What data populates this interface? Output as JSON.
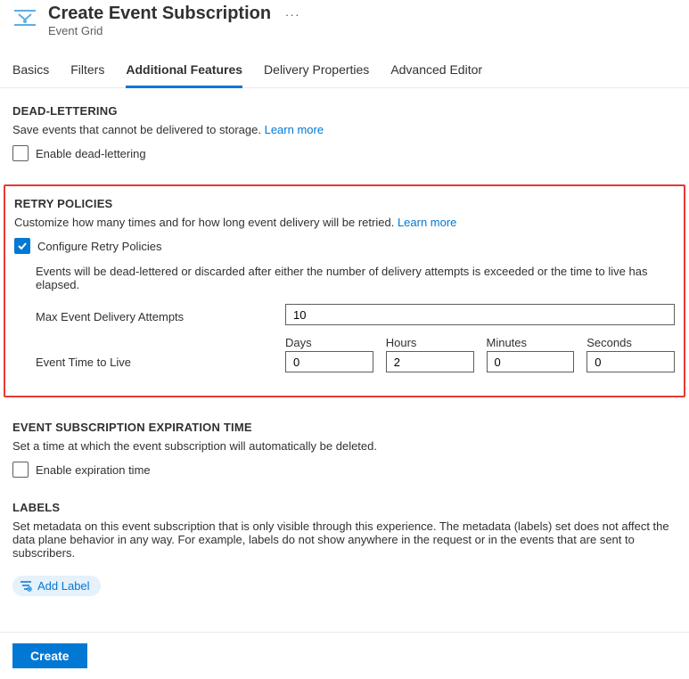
{
  "header": {
    "title": "Create Event Subscription",
    "subtitle": "Event Grid"
  },
  "tabs": {
    "basics": "Basics",
    "filters": "Filters",
    "additional": "Additional Features",
    "delivery": "Delivery Properties",
    "advanced": "Advanced Editor"
  },
  "deadLetter": {
    "title": "DEAD-LETTERING",
    "desc": "Save events that cannot be delivered to storage.",
    "learnMore": "Learn more",
    "enableLabel": "Enable dead-lettering"
  },
  "retry": {
    "title": "RETRY POLICIES",
    "desc": "Customize how many times and for how long event delivery will be retried.",
    "learnMore": "Learn more",
    "configureLabel": "Configure Retry Policies",
    "note": "Events will be dead-lettered or discarded after either the number of delivery attempts is exceeded or the time to live has elapsed.",
    "maxAttemptsLabel": "Max Event Delivery Attempts",
    "maxAttemptsValue": "10",
    "ttlLabel": "Event Time to Live",
    "ttl": {
      "daysLabel": "Days",
      "days": "0",
      "hoursLabel": "Hours",
      "hours": "2",
      "minutesLabel": "Minutes",
      "minutes": "0",
      "secondsLabel": "Seconds",
      "seconds": "0"
    }
  },
  "expiration": {
    "title": "EVENT SUBSCRIPTION EXPIRATION TIME",
    "desc": "Set a time at which the event subscription will automatically be deleted.",
    "enableLabel": "Enable expiration time"
  },
  "labels": {
    "title": "LABELS",
    "desc": "Set metadata on this event subscription that is only visible through this experience. The metadata (labels) set does not affect the data plane behavior in any way. For example, labels do not show anywhere in the request or in the events that are sent to subscribers.",
    "addLabel": "Add Label"
  },
  "footer": {
    "create": "Create"
  }
}
